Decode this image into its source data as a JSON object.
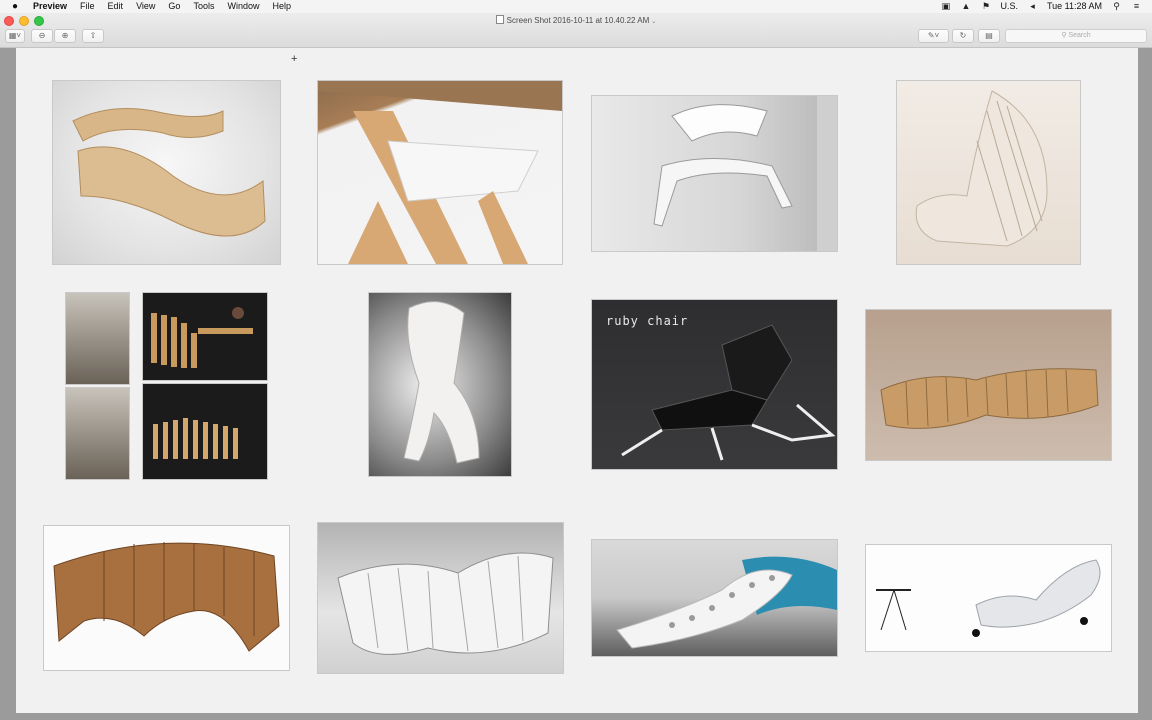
{
  "menubar": {
    "apple": "",
    "app_name": "Preview",
    "menus": [
      "File",
      "Edit",
      "View",
      "Go",
      "Tools",
      "Window",
      "Help"
    ],
    "status": {
      "input_source": "U.S.",
      "clock": "Tue 11:28 AM"
    }
  },
  "window": {
    "title": "Screen Shot 2016-10-11 at 10.40.22 AM",
    "title_caret": "⌄",
    "search_placeholder": "Search"
  },
  "toolbar_icons": [
    "sidebar-icon",
    "zoom-out-icon",
    "zoom-in-icon",
    "share-icon",
    "markup-pen-icon",
    "rotate-icon",
    "toolbox-icon"
  ],
  "document": {
    "images": [
      {
        "subject": "wooden bench pair"
      },
      {
        "subject": "wood table joint"
      },
      {
        "subject": "white chair"
      },
      {
        "subject": "layered rocking chair"
      },
      {
        "subject": "transforming bench"
      },
      {
        "subject": "white sculptural chair"
      },
      {
        "subject": "ruby chair",
        "label": "ruby chair"
      },
      {
        "subject": "wooden layered bench"
      },
      {
        "subject": "wooden layered sofa"
      },
      {
        "subject": "white layered sofa"
      },
      {
        "subject": "white lattice chaise"
      },
      {
        "subject": "white lounge chair with side table"
      }
    ]
  },
  "colors": {
    "menubar_bg": "#f4f4f4",
    "window_bg": "#ececec",
    "page_bg": "#f1f1f1",
    "close": "#fc5b57",
    "minimize": "#fdbc2e",
    "zoom": "#33c748"
  }
}
